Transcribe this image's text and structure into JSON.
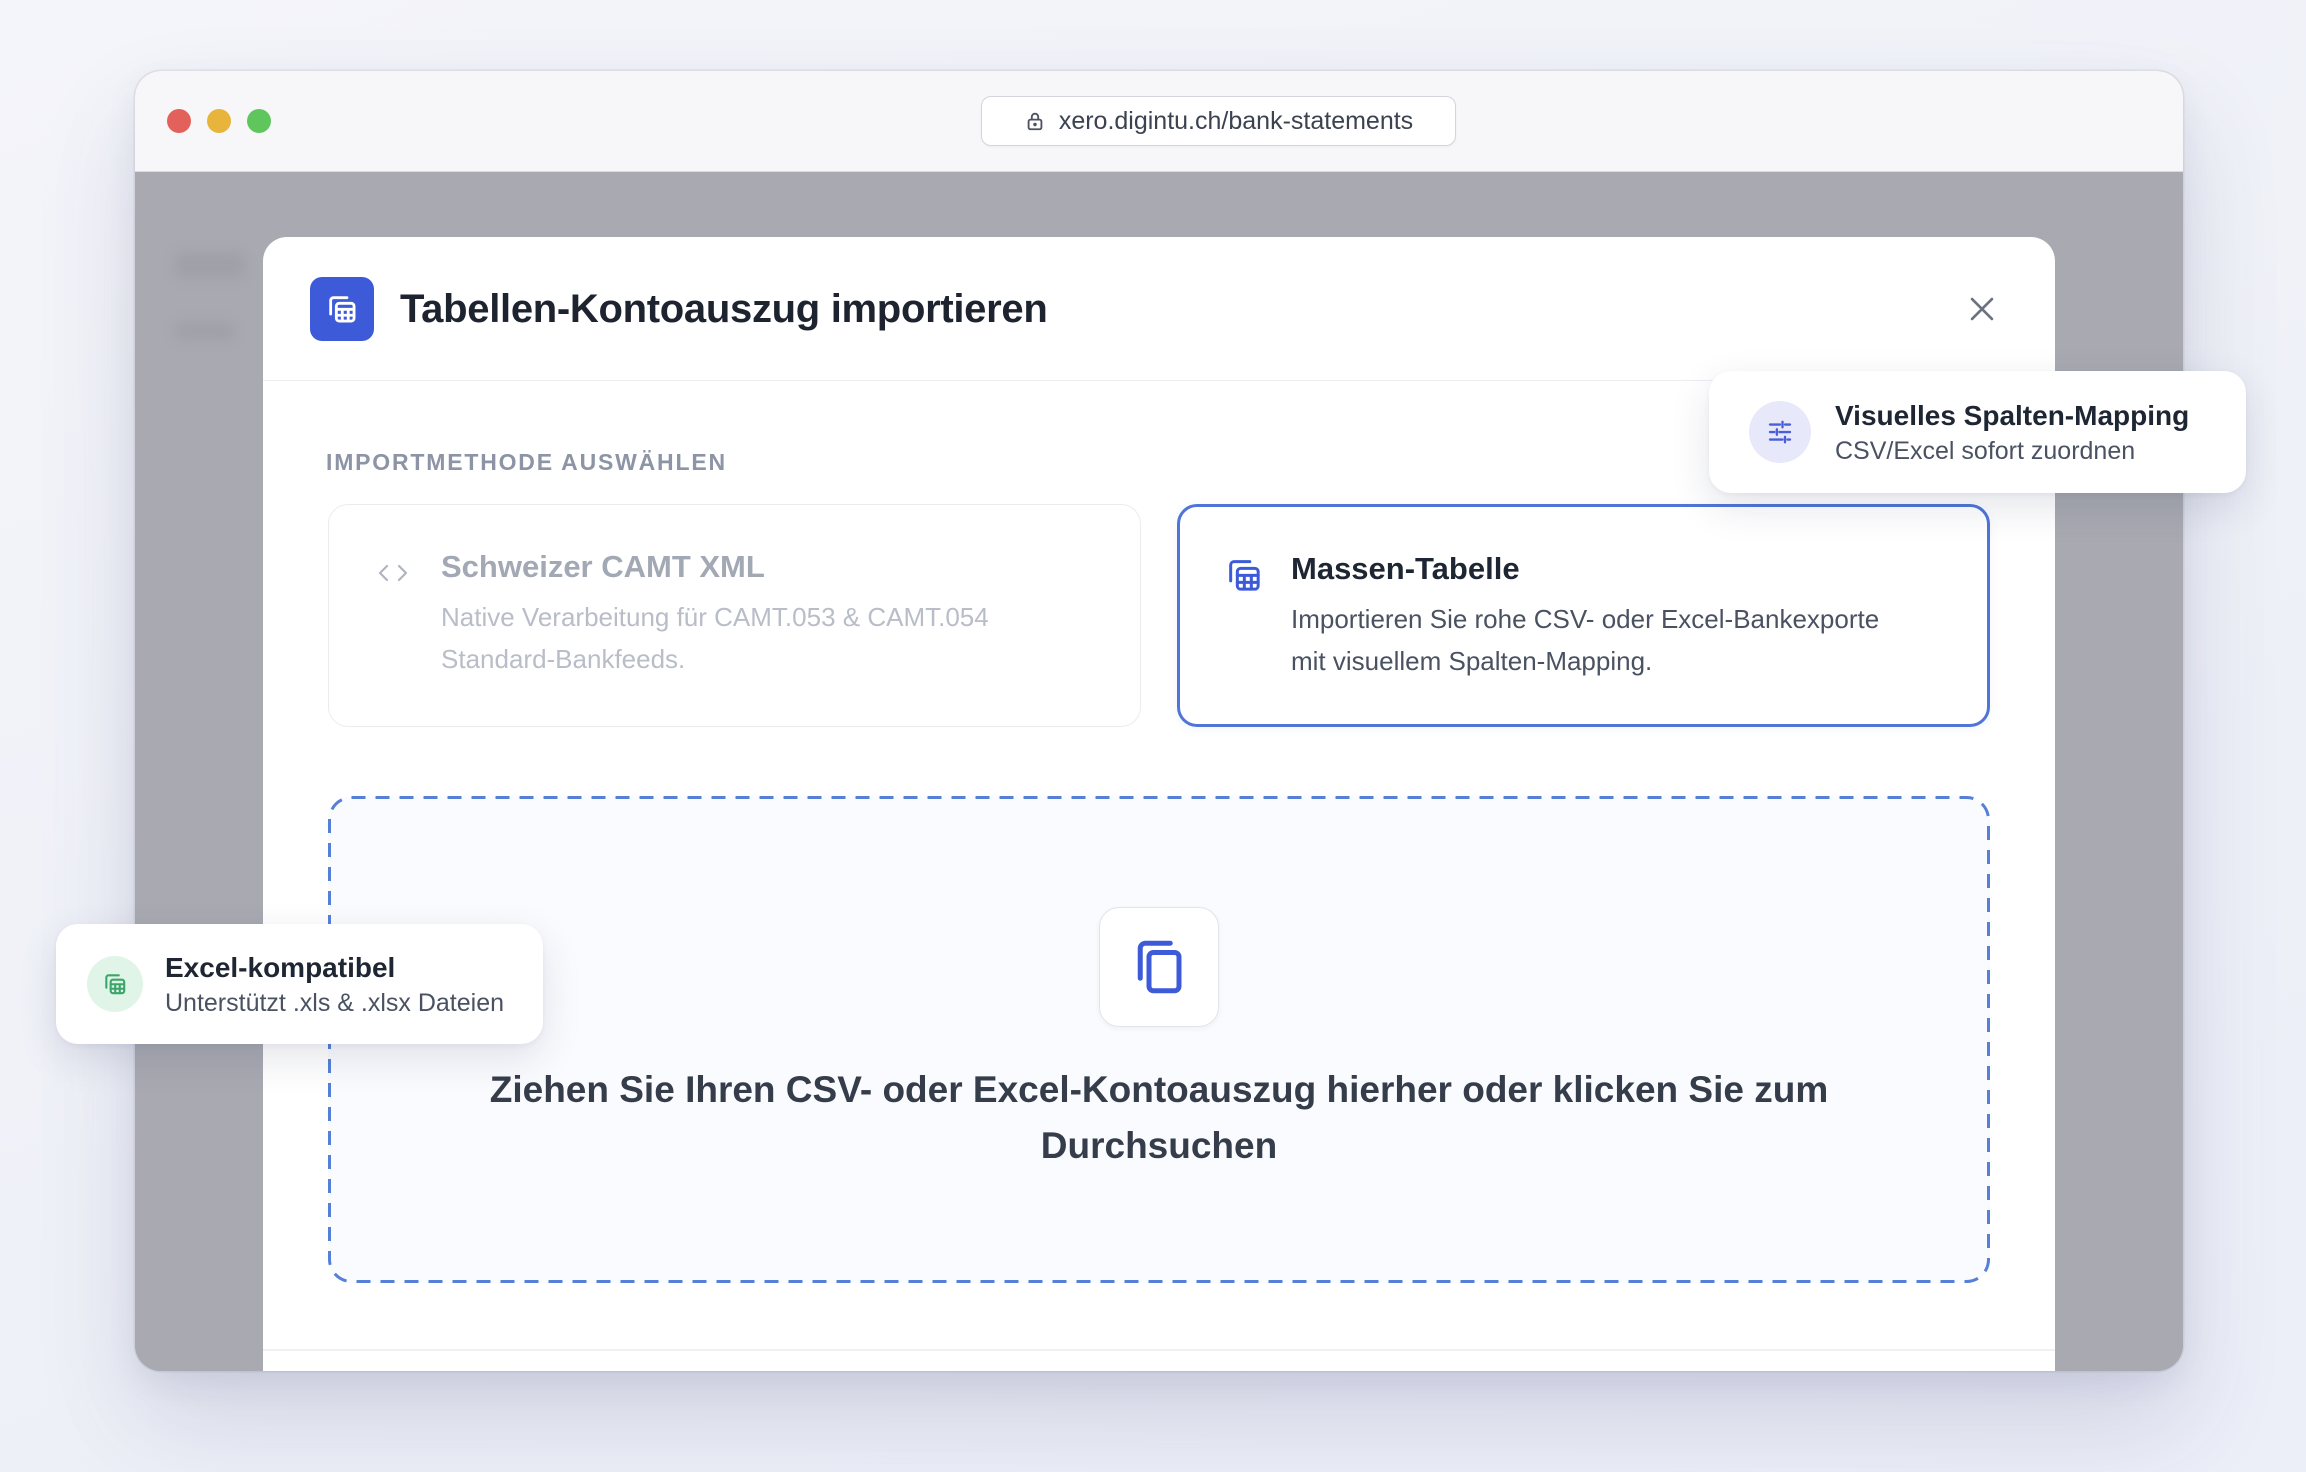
{
  "browser": {
    "url": "xero.digintu.ch/bank-statements",
    "traffic_lights": {
      "close": "#e2615b",
      "minimize": "#e7b53c",
      "zoom": "#5fc65d"
    },
    "lock_icon": "lock-icon"
  },
  "modal": {
    "title": "Tabellen-Kontoauszug importieren",
    "header_icon": "spreadsheet-icon",
    "close_icon": "close-icon",
    "section_label": "IMPORTMETHODE AUSWÄHLEN",
    "methods": [
      {
        "title": "Schweizer CAMT XML",
        "description": "Native Verarbeitung für CAMT.053 & CAMT.054 Standard-Bankfeeds.",
        "icon": "code-icon",
        "selected": false
      },
      {
        "title": "Massen-Tabelle",
        "description": "Importieren Sie rohe CSV- oder Excel-Bankexporte mit visuellem Spalten-Mapping.",
        "icon": "spreadsheet-icon",
        "selected": true
      }
    ],
    "dropzone": {
      "icon": "copy-icon",
      "text": "Ziehen Sie Ihren CSV- oder Excel-Kontoauszug hierher oder klicken Sie zum Durchsuchen"
    }
  },
  "badges": [
    {
      "title": "Visuelles Spalten-Mapping",
      "subtitle": "CSV/Excel sofort zuordnen",
      "icon": "sliders-icon"
    },
    {
      "title": "Excel-kompatibel",
      "subtitle": "Unterstützt .xls & .xlsx Dateien",
      "icon": "spreadsheet-icon"
    }
  ],
  "colors": {
    "accent": "#3d5bd8",
    "selected_border": "#4f75d8",
    "dropzone_dash": "#5680d8",
    "success": "#3ba56a",
    "overlay": "#a8a9b1"
  }
}
